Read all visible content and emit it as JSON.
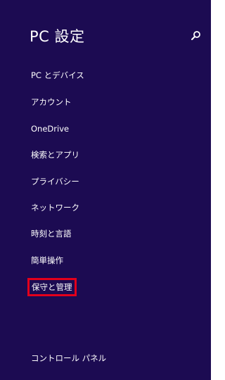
{
  "header": {
    "title": "PC 設定",
    "search_icon": "search-icon"
  },
  "nav": {
    "items": [
      {
        "label": "PC とデバイス"
      },
      {
        "label": "アカウント"
      },
      {
        "label": "OneDrive"
      },
      {
        "label": "検索とアプリ"
      },
      {
        "label": "プライバシー"
      },
      {
        "label": "ネットワーク"
      },
      {
        "label": "時刻と言語"
      },
      {
        "label": "簡単操作"
      },
      {
        "label": "保守と管理",
        "highlighted": true
      }
    ],
    "bottom_link": "コントロール パネル"
  },
  "colors": {
    "background": "#1c0b52",
    "text": "#ffffff",
    "highlight": "#e3001b"
  }
}
